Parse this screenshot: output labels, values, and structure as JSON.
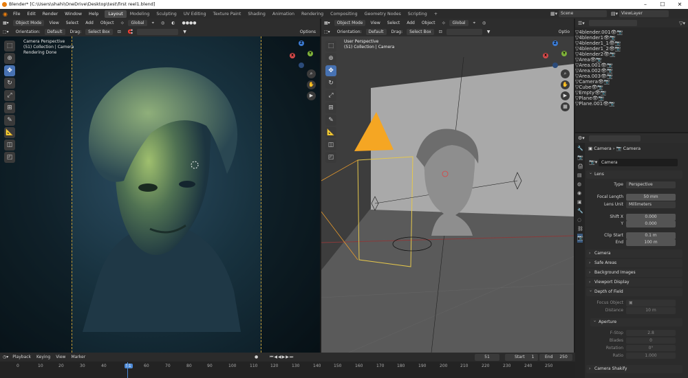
{
  "window": {
    "title": "Blender* [C:\\Users\\shahi\\OneDrive\\Desktop\\test\\first reel1.blend]",
    "minimize": "–",
    "maximize": "☐",
    "close": "✕"
  },
  "menu": [
    "File",
    "Edit",
    "Render",
    "Window",
    "Help"
  ],
  "workspaces": [
    "Layout",
    "Modeling",
    "Sculpting",
    "UV Editing",
    "Texture Paint",
    "Shading",
    "Animation",
    "Rendering",
    "Compositing",
    "Geometry Nodes",
    "Scripting",
    "+"
  ],
  "scene": {
    "label": "Scene",
    "view_layer": "ViewLayer"
  },
  "left_view": {
    "mode": "Object Mode",
    "menus": [
      "View",
      "Select",
      "Add",
      "Object"
    ],
    "orientation_label": "Orientation:",
    "orientation": "Default",
    "drag_label": "Drag:",
    "drag": "Select Box",
    "transform": "Global",
    "options": "Options",
    "info": [
      "Camera Perspective",
      "(51) Collection | Camera",
      "Rendering Done"
    ]
  },
  "right_view": {
    "mode": "Object Mode",
    "menus": [
      "View",
      "Select",
      "Add",
      "Object"
    ],
    "orientation_label": "Orientation:",
    "orientation": "Default",
    "drag_label": "Drag:",
    "drag": "Select Box",
    "transform": "Global",
    "options": "Optio",
    "info": [
      "User Perspective",
      "(51) Collection | Camera"
    ]
  },
  "axes": {
    "x": "X",
    "y": "Y",
    "z": "Z"
  },
  "outliner": [
    {
      "name": "4blender.001",
      "selected": false
    },
    {
      "name": "4blender1",
      "selected": false
    },
    {
      "name": "4blender1_1",
      "selected": false
    },
    {
      "name": "4blender1_2",
      "selected": false
    },
    {
      "name": "4blender2",
      "selected": false
    },
    {
      "name": "Area",
      "selected": false
    },
    {
      "name": "Area.001",
      "selected": false
    },
    {
      "name": "Area.002",
      "selected": false
    },
    {
      "name": "Area.003",
      "selected": false
    },
    {
      "name": "Camera",
      "selected": true
    },
    {
      "name": "Cube",
      "selected": false
    },
    {
      "name": "Empty",
      "selected": false
    },
    {
      "name": "Plane",
      "selected": false
    },
    {
      "name": "Plane.001",
      "selected": false
    }
  ],
  "properties": {
    "breadcrumb": [
      "Camera",
      "Camera"
    ],
    "datablock": "Camera",
    "lens_panel": "Lens",
    "type_label": "Type",
    "type": "Perspective",
    "focal_label": "Focal Length",
    "focal": "50 mm",
    "unit_label": "Lens Unit",
    "unit": "Millimeters",
    "shiftx_label": "Shift X",
    "shiftx": "0.000",
    "shifty_label": "Y",
    "shifty": "0.000",
    "clipstart_label": "Clip Start",
    "clipstart": "0.1 m",
    "clipend_label": "End",
    "clipend": "100 m",
    "panels": [
      "Camera",
      "Safe Areas",
      "Background Images",
      "Viewport Display"
    ],
    "dof": "Depth of Field",
    "focus_label": "Focus Object",
    "distance_label": "Distance",
    "distance": "10 m",
    "aperture": "Aperture",
    "fstop_label": "F-Stop",
    "fstop": "2.8",
    "blades_label": "Blades",
    "blades": "0",
    "rotation_label": "Rotation",
    "rotation": "0°",
    "ratio_label": "Ratio",
    "ratio": "1.000",
    "shakify": "Camera Shakify"
  },
  "timeline": {
    "menus": [
      "Playback",
      "Keying",
      "View",
      "Marker"
    ],
    "current_frame": "51",
    "start_label": "Start",
    "start": "1",
    "end_label": "End",
    "end": "250",
    "ticks": [
      "0",
      "10",
      "20",
      "30",
      "40",
      "51",
      "60",
      "70",
      "80",
      "90",
      "100",
      "110",
      "120",
      "130",
      "140",
      "150",
      "160",
      "170",
      "180",
      "190",
      "200",
      "210",
      "220",
      "230",
      "240",
      "250"
    ]
  }
}
